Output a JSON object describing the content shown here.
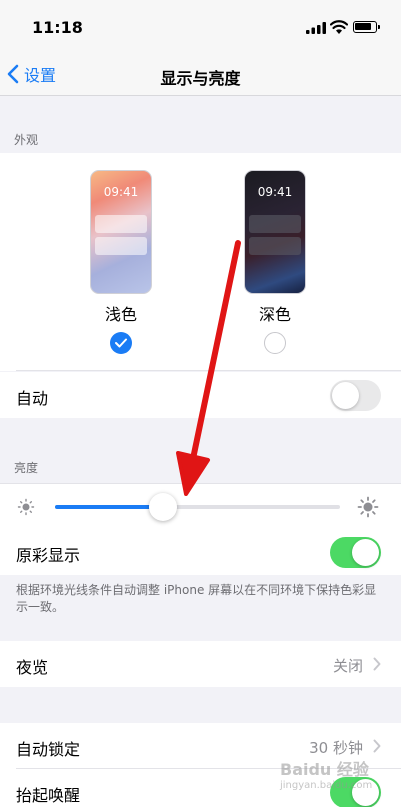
{
  "status": {
    "time": "11:18"
  },
  "nav": {
    "back_label": "设置",
    "title": "显示与亮度"
  },
  "appearance": {
    "section": "外观",
    "preview_time": "09:41",
    "light_label": "浅色",
    "dark_label": "深色",
    "selected": "浅色"
  },
  "auto": {
    "label": "自动",
    "on": false
  },
  "brightness": {
    "section": "亮度",
    "level": 0.38
  },
  "true_tone": {
    "label": "原彩显示",
    "on": true,
    "footnote": "根据环境光线条件自动调整 iPhone 屏幕以在不同环境下保持色彩显示一致。"
  },
  "night_shift": {
    "label": "夜览",
    "value": "关闭"
  },
  "auto_lock": {
    "label": "自动锁定",
    "value": "30 秒钟"
  },
  "raise_to_wake": {
    "label": "抬起唤醒",
    "on": true
  },
  "watermark": {
    "text": "Baidu 经验",
    "sub": "jingyan.baidu.com"
  },
  "colors": {
    "accent": "#1a7cf5",
    "toggle_on": "#4cd964",
    "arrow": "#e01515"
  }
}
